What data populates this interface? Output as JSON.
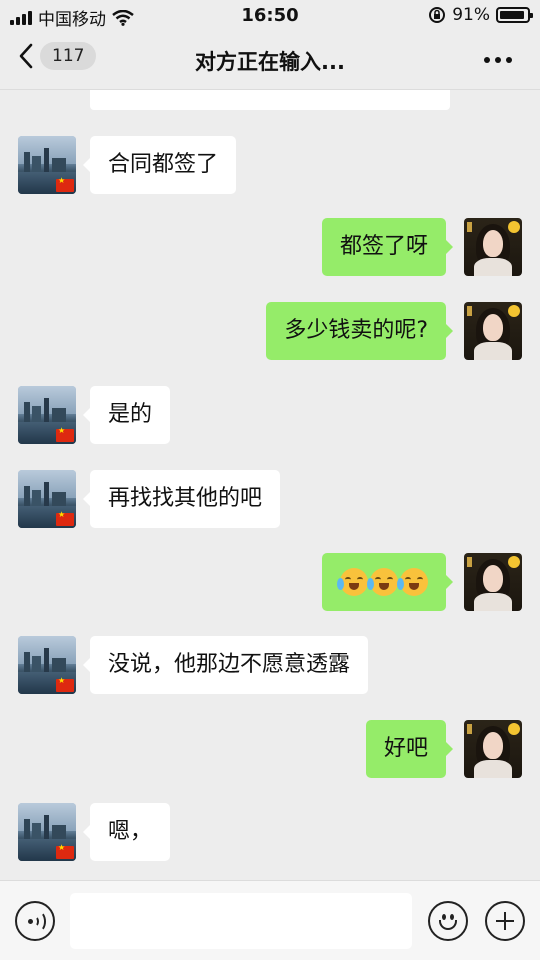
{
  "status_bar": {
    "carrier": "中国移动",
    "time": "16:50",
    "battery_percent": "91%",
    "battery_level": 0.91,
    "icons": [
      "signal-icon",
      "wifi-icon",
      "orientation-lock-icon",
      "battery-icon"
    ]
  },
  "nav": {
    "back_icon": "chevron-left-icon",
    "unread_count": "117",
    "title": "对方正在输入...",
    "more_icon": "more-dots-icon"
  },
  "messages": [
    {
      "side": "left",
      "text": "合同都签了"
    },
    {
      "side": "right",
      "text": "都签了呀"
    },
    {
      "side": "right",
      "text": "多少钱卖的呢?"
    },
    {
      "side": "left",
      "text": "是的"
    },
    {
      "side": "left",
      "text": "再找找其他的吧"
    },
    {
      "side": "right",
      "emoji": [
        "loudly-crying-face",
        "loudly-crying-face",
        "loudly-crying-face"
      ]
    },
    {
      "side": "left",
      "text": "没说，他那边不愿意透露"
    },
    {
      "side": "right",
      "text": "好吧"
    },
    {
      "side": "left",
      "text": "嗯，"
    }
  ],
  "input_bar": {
    "voice_icon": "voice-icon",
    "input_value": "",
    "emoji_icon": "emoji-icon",
    "plus_icon": "plus-icon"
  },
  "colors": {
    "background": "#ededed",
    "outgoing_bubble": "#95ec69",
    "incoming_bubble": "#ffffff"
  }
}
